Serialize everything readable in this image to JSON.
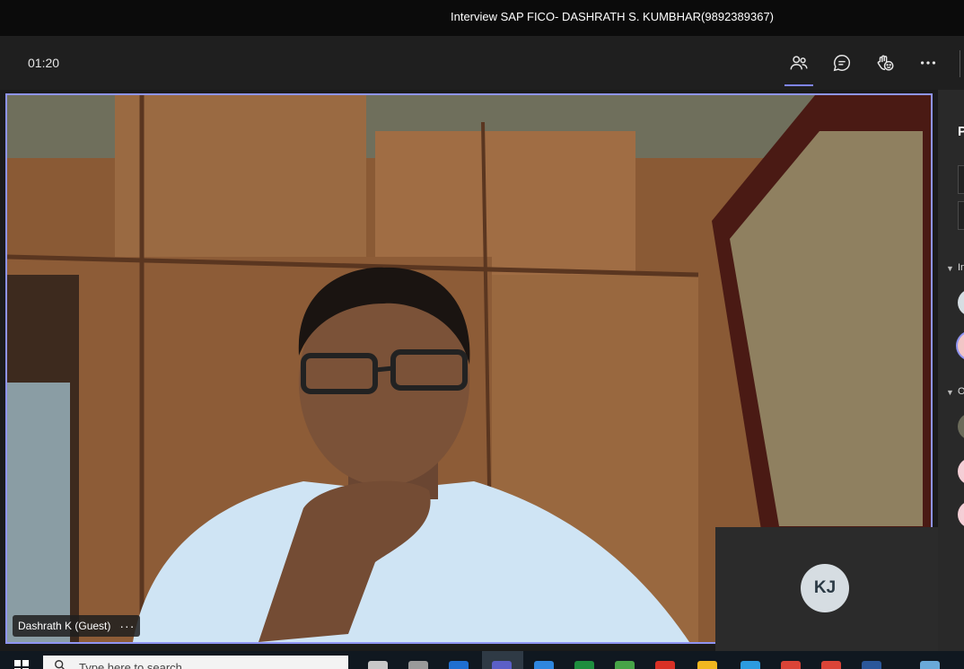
{
  "window": {
    "title": "Interview SAP FICO- DASHRATH S. KUMBHAR(9892389367)"
  },
  "meeting": {
    "timer": "01:20",
    "toolbar": [
      {
        "name": "participants-icon",
        "active": true
      },
      {
        "name": "chat-icon",
        "active": false
      },
      {
        "name": "reactions-icon",
        "active": false
      },
      {
        "name": "more-options-icon",
        "active": false
      }
    ]
  },
  "main_video": {
    "participant_name": "Dashrath K (Guest)",
    "more_label": "···"
  },
  "self_tile": {
    "initials": "KJ"
  },
  "side_panel": {
    "heading_fragment": "P",
    "section_in_fragment": "In",
    "section_other_fragment": "O"
  },
  "taskbar": {
    "search_placeholder": "Type here to search"
  },
  "colors": {
    "active_speaker_border": "#8f94f2",
    "toolbar_bg": "#1f1f1f",
    "title_bg": "#0b0b0b"
  }
}
